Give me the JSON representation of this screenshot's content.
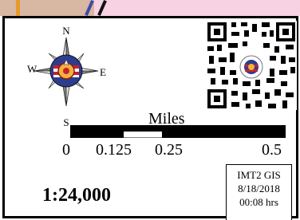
{
  "compass": {
    "north": "N",
    "south": "S",
    "east": "E",
    "west": "W",
    "icon": "compass-rose-icon"
  },
  "qr_code": {
    "icon": "qr-code-icon"
  },
  "scale_bar": {
    "units_label": "Miles",
    "ticks": [
      "0",
      "0.125",
      "0.25",
      "0.5"
    ]
  },
  "ratio_scale": "1:24,000",
  "info_box": {
    "org": "IMT2 GIS",
    "date": "8/18/2018",
    "time": "00:08 hrs"
  }
}
